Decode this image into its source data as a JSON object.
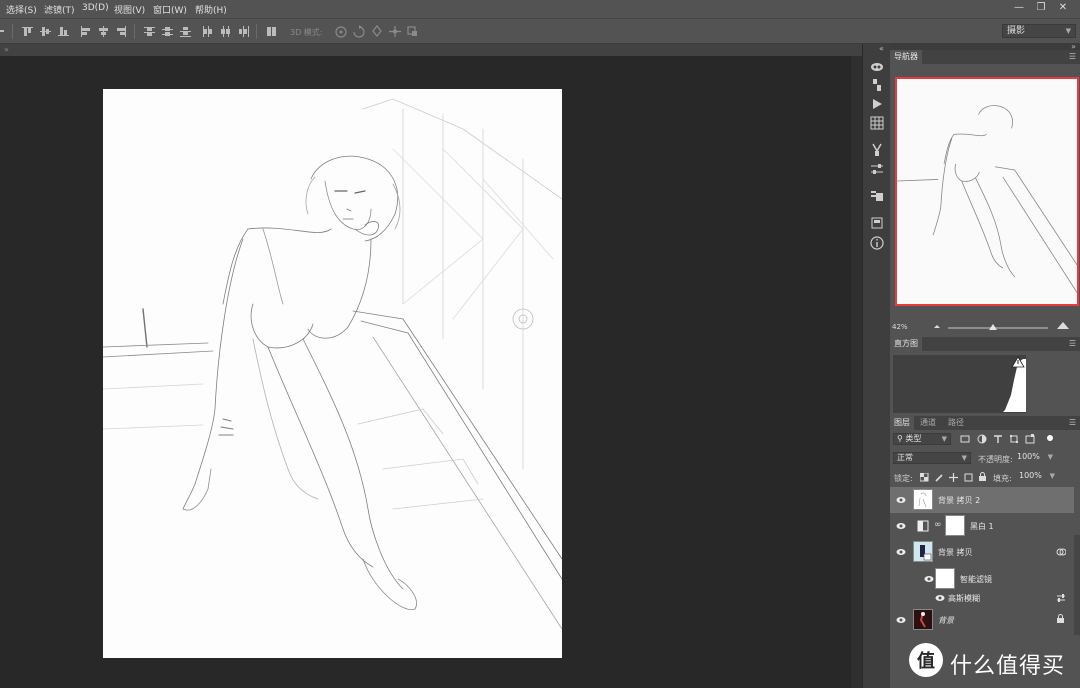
{
  "menu": {
    "items": [
      "选择(S)",
      "滤镜(T)",
      "3D(D)",
      "视图(V)",
      "窗口(W)",
      "帮助(H)"
    ]
  },
  "window_controls": [
    "minimize-icon",
    "restore-icon",
    "close-icon"
  ],
  "options_bar": {
    "mode_3d_label": "3D 模式:",
    "workspace": "摄影"
  },
  "panels": {
    "navigator": {
      "tab": "导航器",
      "zoom": "42%"
    },
    "histogram": {
      "tab": "直方图"
    },
    "layers": {
      "tabs": [
        "图层",
        "通道",
        "路径"
      ],
      "filter_kind": "类型",
      "blend_mode": "正常",
      "opacity_label": "不透明度:",
      "opacity_value": "100%",
      "lock_label": "锁定:",
      "fill_label": "填充:",
      "fill_value": "100%",
      "items": [
        {
          "name": "背景 拷贝 2",
          "selected": true
        },
        {
          "name": "黑白 1"
        },
        {
          "name": "背景 拷贝"
        },
        {
          "name": "智能滤镜"
        },
        {
          "name": "高斯模糊"
        },
        {
          "name": "背景"
        }
      ]
    }
  },
  "watermark": {
    "text": "什么值得买",
    "logo_glyph": "值"
  },
  "colors": {
    "chrome": "#535353",
    "canvas_bg": "#282828",
    "selection_highlight": "#6f6f6f",
    "navigator_frame": "#e33d3d"
  }
}
